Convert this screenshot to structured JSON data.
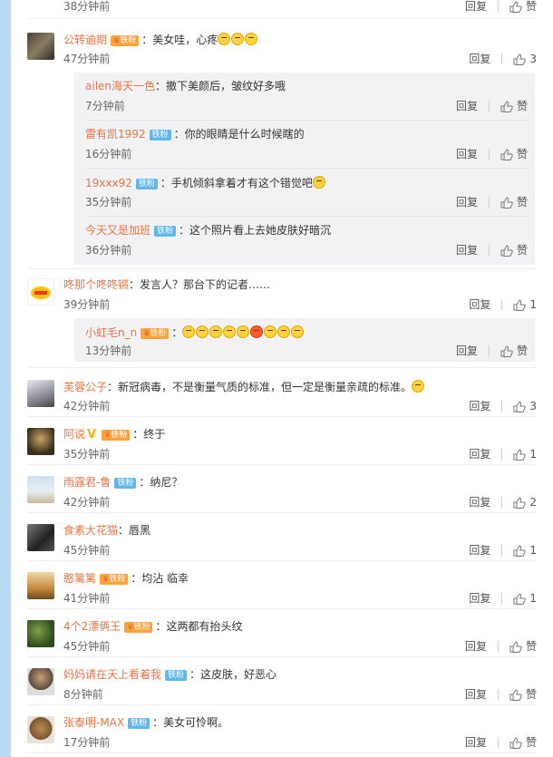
{
  "top": {
    "time": "38分钟前",
    "reply": "回复",
    "like": "赞"
  },
  "comments": [
    {
      "user": "公转逾期",
      "badge": "铁粉",
      "text": "美女哇，心疼",
      "time": "47分钟前",
      "reply": "回复",
      "like": "3",
      "replies": [
        {
          "user": "ailen海天一色",
          "text": "撤下美颜后，皱纹好多哦",
          "time": "7分钟前",
          "reply": "回复",
          "like": "赞"
        },
        {
          "user": "雷有凯1992",
          "badge": "铁粉",
          "text": "你的眼睛是什么时候瞎的",
          "time": "16分钟前",
          "reply": "回复",
          "like": "赞"
        },
        {
          "user": "19xxx92",
          "badge": "铁粉",
          "text": "手机倾斜拿着才有这个错觉吧",
          "time": "35分钟前",
          "reply": "回复",
          "like": "赞"
        },
        {
          "user": "今天又是加班",
          "badge": "铁粉",
          "text": "这个照片看上去她皮肤好暗沉",
          "time": "36分钟前",
          "reply": "回复",
          "like": "赞"
        }
      ]
    },
    {
      "user": "咚那个咚咚锵",
      "text": "发言人？那台下的记者……",
      "time": "39分钟前",
      "reply": "回复",
      "like": "1",
      "replies": [
        {
          "user": "小虹毛n_n",
          "badge": "铁粉",
          "text": "",
          "time": "13分钟前",
          "reply": "回复",
          "like": "赞"
        }
      ]
    },
    {
      "user": "芙蓉公子",
      "text": "新冠病毒，不是衡量气质的标准，但一定是衡量亲疏的标准。",
      "time": "42分钟前",
      "reply": "回复",
      "like": "3"
    },
    {
      "user": "阿说",
      "badge": "铁粉",
      "text": "终于",
      "time": "35分钟前",
      "reply": "回复",
      "like": "1"
    },
    {
      "user": "雨露君-鲁",
      "badge": "铁粉",
      "text": "纳尼？",
      "time": "42分钟前",
      "reply": "回复",
      "like": "2"
    },
    {
      "user": "食素大花猫",
      "text": "唇黑",
      "time": "45分钟前",
      "reply": "回复",
      "like": "1"
    },
    {
      "user": "憨篱篱",
      "badge": "铁粉",
      "text": "均沾  临幸",
      "time": "41分钟前",
      "reply": "回复",
      "like": "1"
    },
    {
      "user": "4个2漂俩王",
      "badge": "铁粉",
      "text": "这两都有抬头纹",
      "time": "45分钟前",
      "reply": "回复",
      "like": "赞"
    },
    {
      "user": "妈妈请在天上看着我",
      "badge": "铁粉",
      "text": "这皮肤，好恶心",
      "time": "8分钟前",
      "reply": "回复",
      "like": "赞"
    },
    {
      "user": "张泰明-MAX",
      "badge": "铁粉",
      "text": "美女可怜啊。",
      "time": "17分钟前",
      "reply": "回复",
      "like": "赞"
    }
  ],
  "colors": {
    "username": "#eb7340",
    "badge_blue": "#61b6ec",
    "badge_gold": "#ffa23b",
    "sidebar": "#b9d9f4"
  }
}
